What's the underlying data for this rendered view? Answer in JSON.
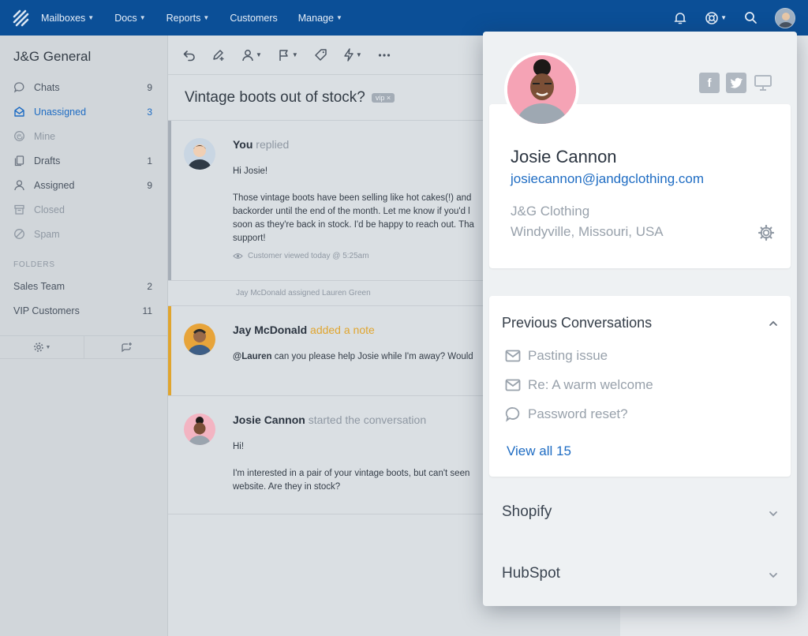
{
  "nav": {
    "items": [
      {
        "label": "Mailboxes",
        "caret": true
      },
      {
        "label": "Docs",
        "caret": true
      },
      {
        "label": "Reports",
        "caret": true
      },
      {
        "label": "Customers",
        "caret": false
      },
      {
        "label": "Manage",
        "caret": true
      }
    ],
    "right_icons": [
      "bell-icon",
      "help-lifebuoy-icon",
      "search-icon",
      "user-avatar"
    ]
  },
  "sidebar": {
    "mailbox_title": "J&G General",
    "items": [
      {
        "label": "Chats",
        "count": "9",
        "icon": "chat-icon",
        "state": "normal"
      },
      {
        "label": "Unassigned",
        "count": "3",
        "icon": "inbox-icon",
        "state": "active"
      },
      {
        "label": "Mine",
        "count": "",
        "icon": "hand-icon",
        "state": "muted"
      },
      {
        "label": "Drafts",
        "count": "1",
        "icon": "drafts-icon",
        "state": "normal"
      },
      {
        "label": "Assigned",
        "count": "9",
        "icon": "person-icon",
        "state": "normal"
      },
      {
        "label": "Closed",
        "count": "",
        "icon": "archive-icon",
        "state": "muted"
      },
      {
        "label": "Spam",
        "count": "",
        "icon": "spam-icon",
        "state": "muted"
      }
    ],
    "folders_header": "FOLDERS",
    "folders": [
      {
        "label": "Sales Team",
        "count": "2"
      },
      {
        "label": "VIP Customers",
        "count": "11"
      }
    ]
  },
  "conversation": {
    "subject": "Vintage boots out of stock?",
    "tag": "vip ×",
    "messages": [
      {
        "author": "You",
        "action": "replied",
        "body": [
          "Hi Josie!",
          "Those vintage boots have been selling like hot cakes(!) and backorder until the end of the month. Let me know if you'd l soon as they're back in stock. I'd be happy to reach out. Tha support!"
        ],
        "viewed": "Customer viewed today @ 5:25am"
      },
      {
        "author": "Jay McDonald",
        "action": "added a note",
        "mention": "@Lauren",
        "body_rest": " can you please help Josie while I'm away? Would"
      },
      {
        "author": "Josie Cannon",
        "action": "started the conversation",
        "body": [
          "Hi!",
          "I'm interested in a pair of your vintage boots, but can't seen website. Are they in stock?"
        ]
      }
    ],
    "assignment_note": "Jay McDonald assigned Lauren Green"
  },
  "customer": {
    "name": "Josie Cannon",
    "email": "josiecannon@jandgclothing.com",
    "company": "J&G Clothing",
    "location": "Windyville, Missouri, USA",
    "socials": [
      "facebook-icon",
      "twitter-icon",
      "desktop-icon"
    ]
  },
  "previous": {
    "title": "Previous Conversations",
    "items": [
      {
        "label": "Pasting issue",
        "icon": "mail-icon"
      },
      {
        "label": "Re: A warm welcome",
        "icon": "mail-icon"
      },
      {
        "label": "Password reset?",
        "icon": "chat-icon"
      }
    ],
    "view_all": "View all 15"
  },
  "integrations": [
    "Shopify",
    "HubSpot"
  ],
  "colors": {
    "brand": "#0b4f97",
    "link": "#1e6cc3",
    "note": "#e0a52f"
  }
}
